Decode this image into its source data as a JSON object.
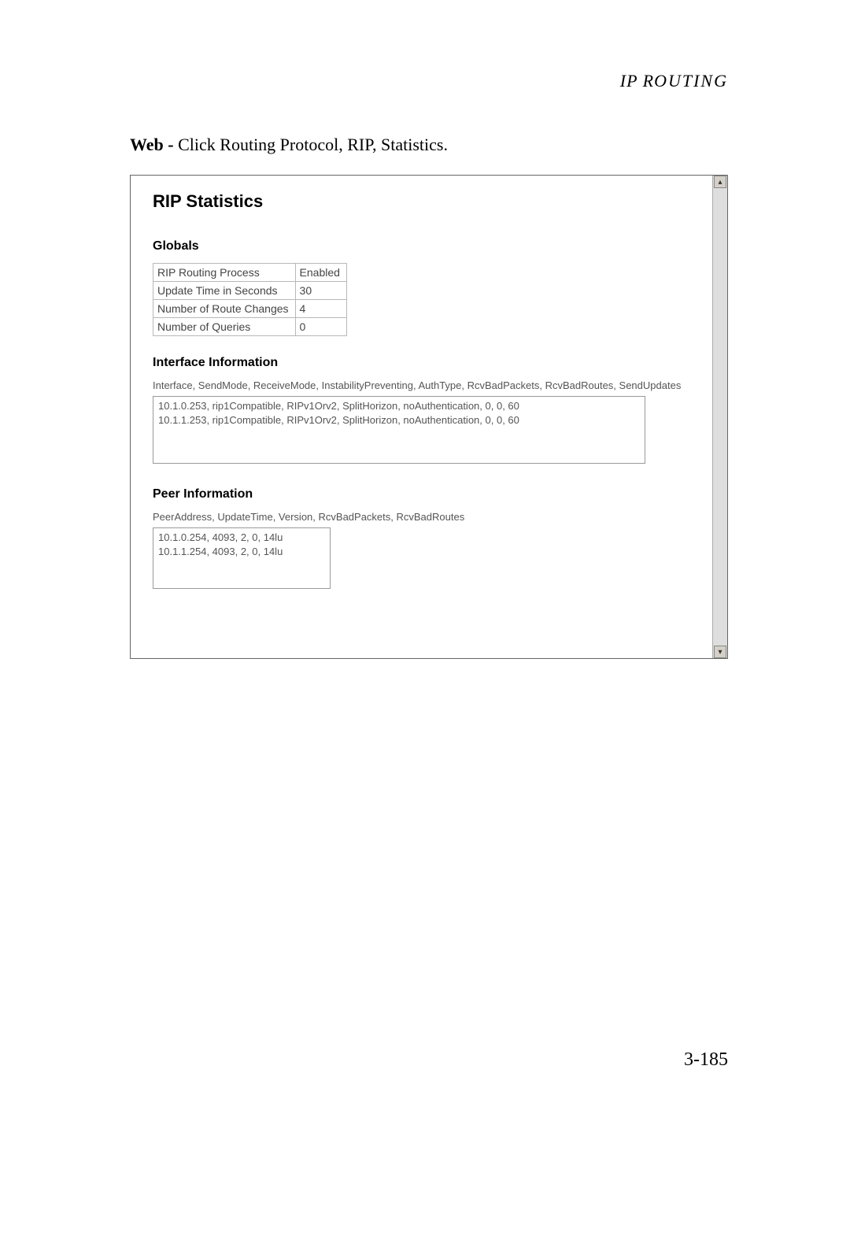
{
  "header": "IP ROUTING",
  "instruction_prefix": "Web - ",
  "instruction_text": "Click Routing Protocol, RIP, Statistics.",
  "page_number": "3-185",
  "screenshot": {
    "title": "RIP Statistics",
    "globals": {
      "heading": "Globals",
      "rows": [
        {
          "label": "RIP Routing Process",
          "value": "Enabled"
        },
        {
          "label": "Update Time in Seconds",
          "value": "30"
        },
        {
          "label": "Number of Route Changes",
          "value": "4"
        },
        {
          "label": "Number of Queries",
          "value": "0"
        }
      ]
    },
    "interface": {
      "heading": "Interface Information",
      "columns": "Interface, SendMode, ReceiveMode, InstabilityPreventing, AuthType, RcvBadPackets, RcvBadRoutes, SendUpdates",
      "rows": [
        "10.1.0.253, rip1Compatible, RIPv1Orv2, SplitHorizon, noAuthentication, 0, 0, 60",
        "10.1.1.253, rip1Compatible, RIPv1Orv2, SplitHorizon, noAuthentication, 0, 0, 60"
      ]
    },
    "peer": {
      "heading": "Peer Information",
      "columns": "PeerAddress, UpdateTime, Version, RcvBadPackets, RcvBadRoutes",
      "rows": [
        "10.1.0.254, 4093, 2, 0, 14lu",
        "10.1.1.254, 4093, 2, 0, 14lu"
      ]
    }
  }
}
